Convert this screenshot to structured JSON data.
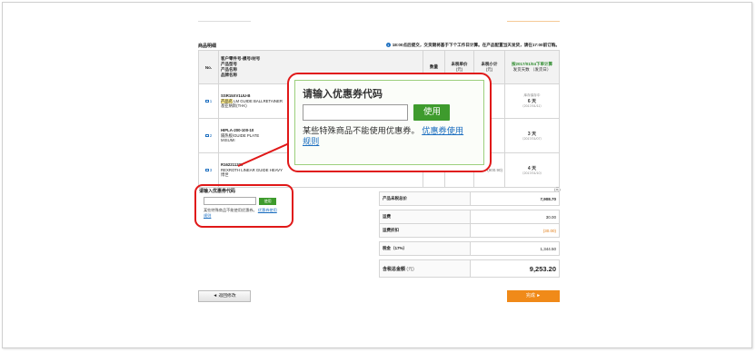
{
  "section_title": "商品明细",
  "notice": "18:00点后提交，交货期将基于下个工作日计算。在产品配置当天发货，请在17:00前订购。",
  "table": {
    "headers": {
      "no": "No.",
      "product_lines": [
        "客户零件号-模号/材号",
        "产品型号",
        "产品名称",
        "品牌名称"
      ],
      "qty": "数量",
      "unit_price": "未税单价",
      "unit_price_unit": "(元)",
      "subtotal": "未税小计",
      "subtotal_unit": "(元)",
      "ship_title": "按2017/01/04下单计算",
      "ship_sub": "发货天数 （发货日）"
    },
    "rows": [
      {
        "no": "1",
        "code": "SSR15XV1UU-B",
        "tag": "产品名",
        "name": "LM GUIDE BALLRETAINER",
        "brand": "基亚纳斯(THK)",
        "unit_price": "",
        "subtotal": "",
        "days_note": "库存保存中",
        "days": "6 天",
        "date": "（2017/01/11）"
      },
      {
        "no": "2",
        "code": "HIPLA-200-100-10",
        "tag": "",
        "name": "隔热板/GUIDE PLATE",
        "brand": "MISUMI",
        "unit_price": "",
        "subtotal": "",
        "days_note": "",
        "days": "3 天",
        "date": "（2017/01/07）"
      },
      {
        "no": "3",
        "code": "R162211320",
        "tag": "",
        "name": "REXROTH LINEAR GUIDE HEAVY",
        "brand": "博世",
        "unit_price": "(450.45)",
        "subtotal": "(900.90)",
        "days_note": "",
        "days": "4 天",
        "date": "（2017/01/10）"
      }
    ]
  },
  "coupon_small": {
    "title": "请输入优惠券代码",
    "button": "使用",
    "message": "某些特殊商品不能使用优惠券。",
    "link_a": "优惠券使用",
    "link_b": "规则"
  },
  "coupon_popup": {
    "title": "请输入优惠券代码",
    "button": "使用",
    "message": "某些特殊商品不能使用优惠券。",
    "link_a": "优惠券使用",
    "link_b": "规则"
  },
  "totals": {
    "unit": "(元)",
    "rows": [
      {
        "label": "产品未税总价",
        "value": "7,908.70"
      },
      {
        "label": "运费",
        "value": "30.00"
      },
      {
        "label": "运费折扣",
        "value": "(30.00)"
      },
      {
        "label": "税金（17%）",
        "value": "1,344.50"
      }
    ],
    "total_label": "含税总金额",
    "total_tax": "(元)",
    "total_value": "9,253.20"
  },
  "buttons": {
    "back": "◄ 返回修改",
    "next": "完成 ►"
  },
  "colors": {
    "highlight_red": "#e01818",
    "use_button_green": "#3e9b2d",
    "link_blue": "#1d6fc0",
    "finish_orange": "#f08a19"
  }
}
